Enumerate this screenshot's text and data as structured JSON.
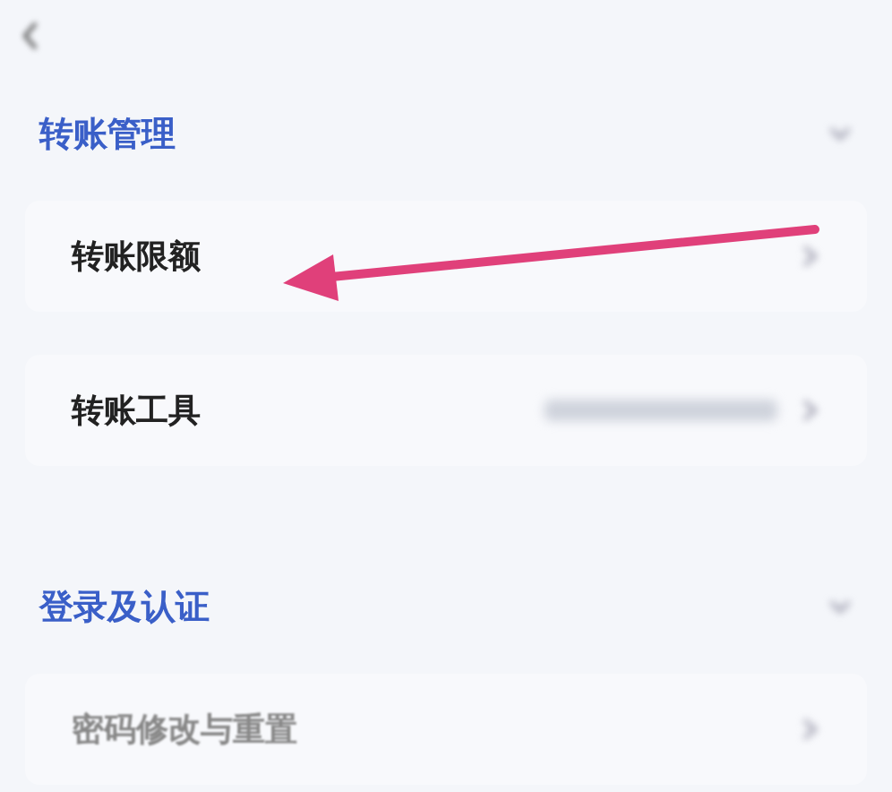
{
  "sections": [
    {
      "title": "转账管理",
      "rows": [
        {
          "label": "转账限额",
          "has_value": false
        },
        {
          "label": "转账工具",
          "has_value": true
        }
      ]
    },
    {
      "title": "登录及认证",
      "rows": [
        {
          "label": "密码修改与重置",
          "has_value": false
        }
      ]
    }
  ],
  "annotation": {
    "kind": "arrow",
    "color": "#e0407a"
  }
}
